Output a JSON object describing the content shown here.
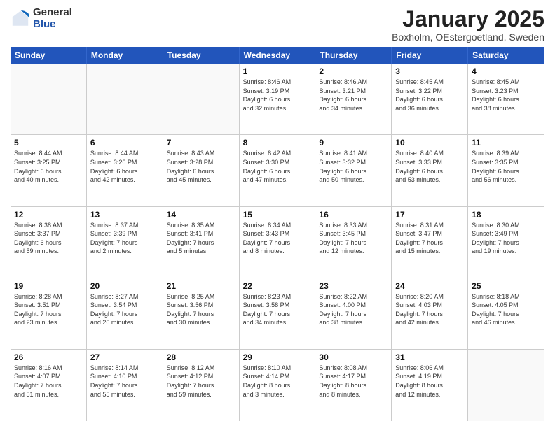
{
  "logo": {
    "general": "General",
    "blue": "Blue"
  },
  "title": {
    "month": "January 2025",
    "location": "Boxholm, OEstergoetland, Sweden"
  },
  "weekdays": [
    "Sunday",
    "Monday",
    "Tuesday",
    "Wednesday",
    "Thursday",
    "Friday",
    "Saturday"
  ],
  "weeks": [
    [
      {
        "day": "",
        "info": ""
      },
      {
        "day": "",
        "info": ""
      },
      {
        "day": "",
        "info": ""
      },
      {
        "day": "1",
        "info": "Sunrise: 8:46 AM\nSunset: 3:19 PM\nDaylight: 6 hours\nand 32 minutes."
      },
      {
        "day": "2",
        "info": "Sunrise: 8:46 AM\nSunset: 3:21 PM\nDaylight: 6 hours\nand 34 minutes."
      },
      {
        "day": "3",
        "info": "Sunrise: 8:45 AM\nSunset: 3:22 PM\nDaylight: 6 hours\nand 36 minutes."
      },
      {
        "day": "4",
        "info": "Sunrise: 8:45 AM\nSunset: 3:23 PM\nDaylight: 6 hours\nand 38 minutes."
      }
    ],
    [
      {
        "day": "5",
        "info": "Sunrise: 8:44 AM\nSunset: 3:25 PM\nDaylight: 6 hours\nand 40 minutes."
      },
      {
        "day": "6",
        "info": "Sunrise: 8:44 AM\nSunset: 3:26 PM\nDaylight: 6 hours\nand 42 minutes."
      },
      {
        "day": "7",
        "info": "Sunrise: 8:43 AM\nSunset: 3:28 PM\nDaylight: 6 hours\nand 45 minutes."
      },
      {
        "day": "8",
        "info": "Sunrise: 8:42 AM\nSunset: 3:30 PM\nDaylight: 6 hours\nand 47 minutes."
      },
      {
        "day": "9",
        "info": "Sunrise: 8:41 AM\nSunset: 3:32 PM\nDaylight: 6 hours\nand 50 minutes."
      },
      {
        "day": "10",
        "info": "Sunrise: 8:40 AM\nSunset: 3:33 PM\nDaylight: 6 hours\nand 53 minutes."
      },
      {
        "day": "11",
        "info": "Sunrise: 8:39 AM\nSunset: 3:35 PM\nDaylight: 6 hours\nand 56 minutes."
      }
    ],
    [
      {
        "day": "12",
        "info": "Sunrise: 8:38 AM\nSunset: 3:37 PM\nDaylight: 6 hours\nand 59 minutes."
      },
      {
        "day": "13",
        "info": "Sunrise: 8:37 AM\nSunset: 3:39 PM\nDaylight: 7 hours\nand 2 minutes."
      },
      {
        "day": "14",
        "info": "Sunrise: 8:35 AM\nSunset: 3:41 PM\nDaylight: 7 hours\nand 5 minutes."
      },
      {
        "day": "15",
        "info": "Sunrise: 8:34 AM\nSunset: 3:43 PM\nDaylight: 7 hours\nand 8 minutes."
      },
      {
        "day": "16",
        "info": "Sunrise: 8:33 AM\nSunset: 3:45 PM\nDaylight: 7 hours\nand 12 minutes."
      },
      {
        "day": "17",
        "info": "Sunrise: 8:31 AM\nSunset: 3:47 PM\nDaylight: 7 hours\nand 15 minutes."
      },
      {
        "day": "18",
        "info": "Sunrise: 8:30 AM\nSunset: 3:49 PM\nDaylight: 7 hours\nand 19 minutes."
      }
    ],
    [
      {
        "day": "19",
        "info": "Sunrise: 8:28 AM\nSunset: 3:51 PM\nDaylight: 7 hours\nand 23 minutes."
      },
      {
        "day": "20",
        "info": "Sunrise: 8:27 AM\nSunset: 3:54 PM\nDaylight: 7 hours\nand 26 minutes."
      },
      {
        "day": "21",
        "info": "Sunrise: 8:25 AM\nSunset: 3:56 PM\nDaylight: 7 hours\nand 30 minutes."
      },
      {
        "day": "22",
        "info": "Sunrise: 8:23 AM\nSunset: 3:58 PM\nDaylight: 7 hours\nand 34 minutes."
      },
      {
        "day": "23",
        "info": "Sunrise: 8:22 AM\nSunset: 4:00 PM\nDaylight: 7 hours\nand 38 minutes."
      },
      {
        "day": "24",
        "info": "Sunrise: 8:20 AM\nSunset: 4:03 PM\nDaylight: 7 hours\nand 42 minutes."
      },
      {
        "day": "25",
        "info": "Sunrise: 8:18 AM\nSunset: 4:05 PM\nDaylight: 7 hours\nand 46 minutes."
      }
    ],
    [
      {
        "day": "26",
        "info": "Sunrise: 8:16 AM\nSunset: 4:07 PM\nDaylight: 7 hours\nand 51 minutes."
      },
      {
        "day": "27",
        "info": "Sunrise: 8:14 AM\nSunset: 4:10 PM\nDaylight: 7 hours\nand 55 minutes."
      },
      {
        "day": "28",
        "info": "Sunrise: 8:12 AM\nSunset: 4:12 PM\nDaylight: 7 hours\nand 59 minutes."
      },
      {
        "day": "29",
        "info": "Sunrise: 8:10 AM\nSunset: 4:14 PM\nDaylight: 8 hours\nand 3 minutes."
      },
      {
        "day": "30",
        "info": "Sunrise: 8:08 AM\nSunset: 4:17 PM\nDaylight: 8 hours\nand 8 minutes."
      },
      {
        "day": "31",
        "info": "Sunrise: 8:06 AM\nSunset: 4:19 PM\nDaylight: 8 hours\nand 12 minutes."
      },
      {
        "day": "",
        "info": ""
      }
    ]
  ]
}
